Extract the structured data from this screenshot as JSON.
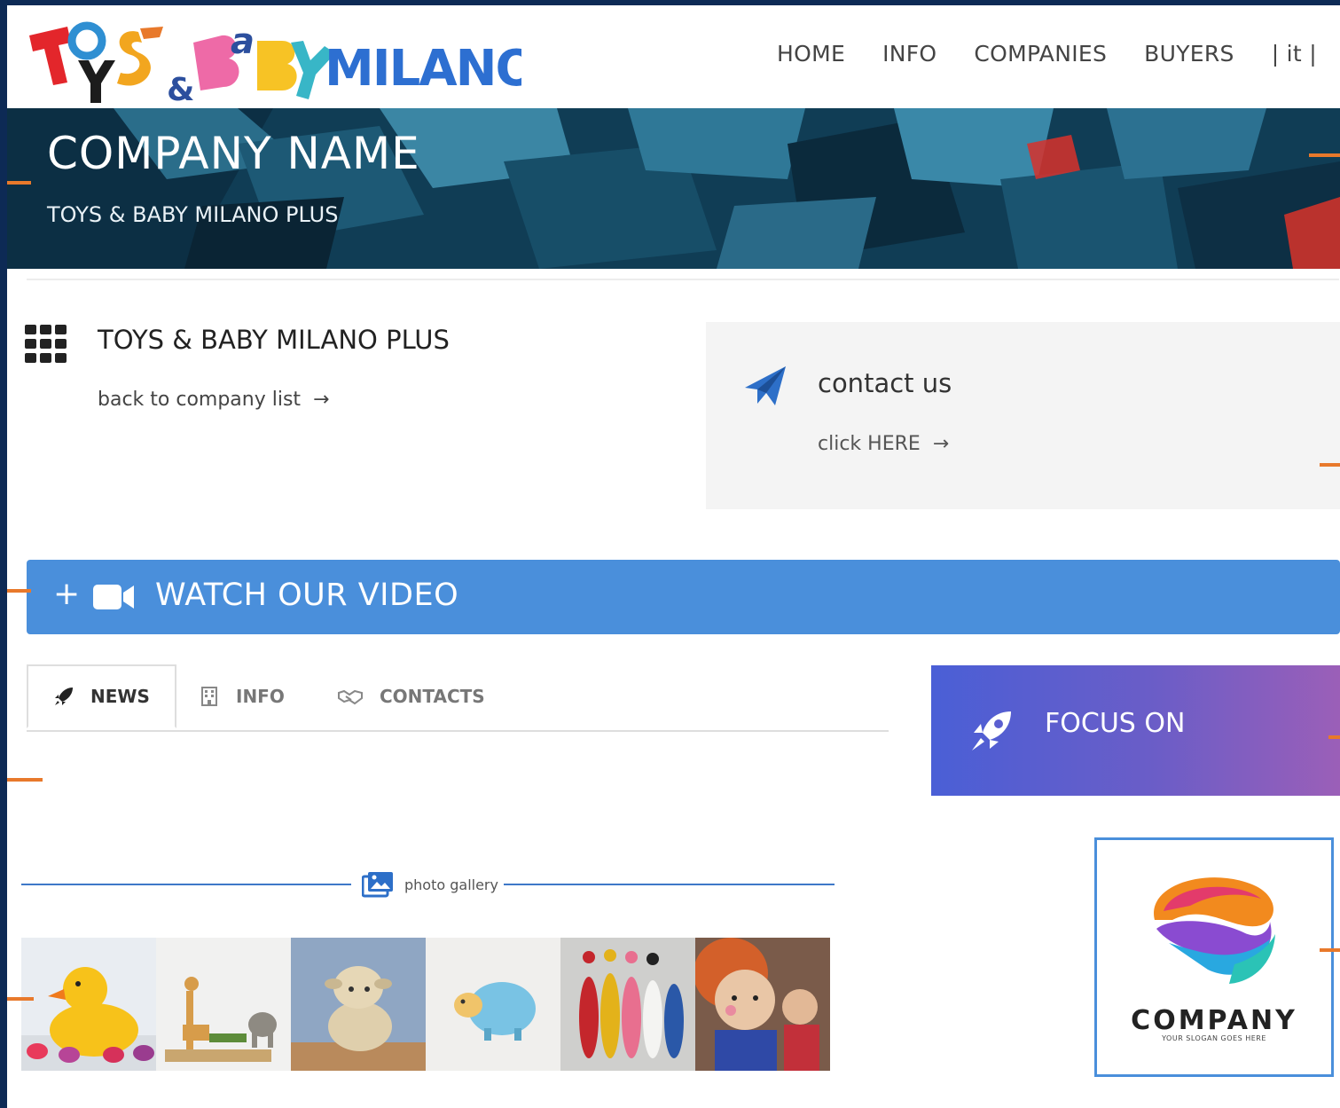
{
  "header": {
    "logo": {
      "text": "TOYS & BABY MILANO",
      "alt": "Toys & Baby Milano logo"
    },
    "nav": [
      {
        "label": "HOME"
      },
      {
        "label": "INFO"
      },
      {
        "label": "COMPANIES"
      },
      {
        "label": "BUYERS"
      },
      {
        "label": "| it |"
      }
    ]
  },
  "hero": {
    "title": "COMPANY NAME",
    "subtitle": "TOYS & BABY MILANO PLUS"
  },
  "company": {
    "name": "TOYS & BABY MILANO PLUS",
    "back_link": "back to company list"
  },
  "contact": {
    "title": "contact us",
    "link": "click HERE"
  },
  "video": {
    "plus": "+",
    "label": "WATCH OUR VIDEO"
  },
  "tabs": [
    {
      "label": "NEWS",
      "icon": "rocket-icon",
      "active": true
    },
    {
      "label": "INFO",
      "icon": "building-icon",
      "active": false
    },
    {
      "label": "CONTACTS",
      "icon": "handshake-icon",
      "active": false
    }
  ],
  "focus": {
    "label": "FOCUS ON"
  },
  "gallery": {
    "label": "photo gallery",
    "photos": [
      {
        "subject": "rubber ducks"
      },
      {
        "subject": "wooden animals"
      },
      {
        "subject": "plush sheep"
      },
      {
        "subject": "blue toy sheep"
      },
      {
        "subject": "skittles"
      },
      {
        "subject": "knitted dolls"
      }
    ]
  },
  "sponsor_logo": {
    "word": "COMPANY",
    "slogan": "YOUR SLOGAN GOES HERE"
  },
  "colors": {
    "frame": "#0d2a55",
    "accent_tick": "#e8792b",
    "video_bar": "#4a8fdb",
    "focus_gradient_start": "#4a5fd6",
    "focus_gradient_end": "#9b5fb8",
    "gallery_rule": "#3e78c8"
  }
}
